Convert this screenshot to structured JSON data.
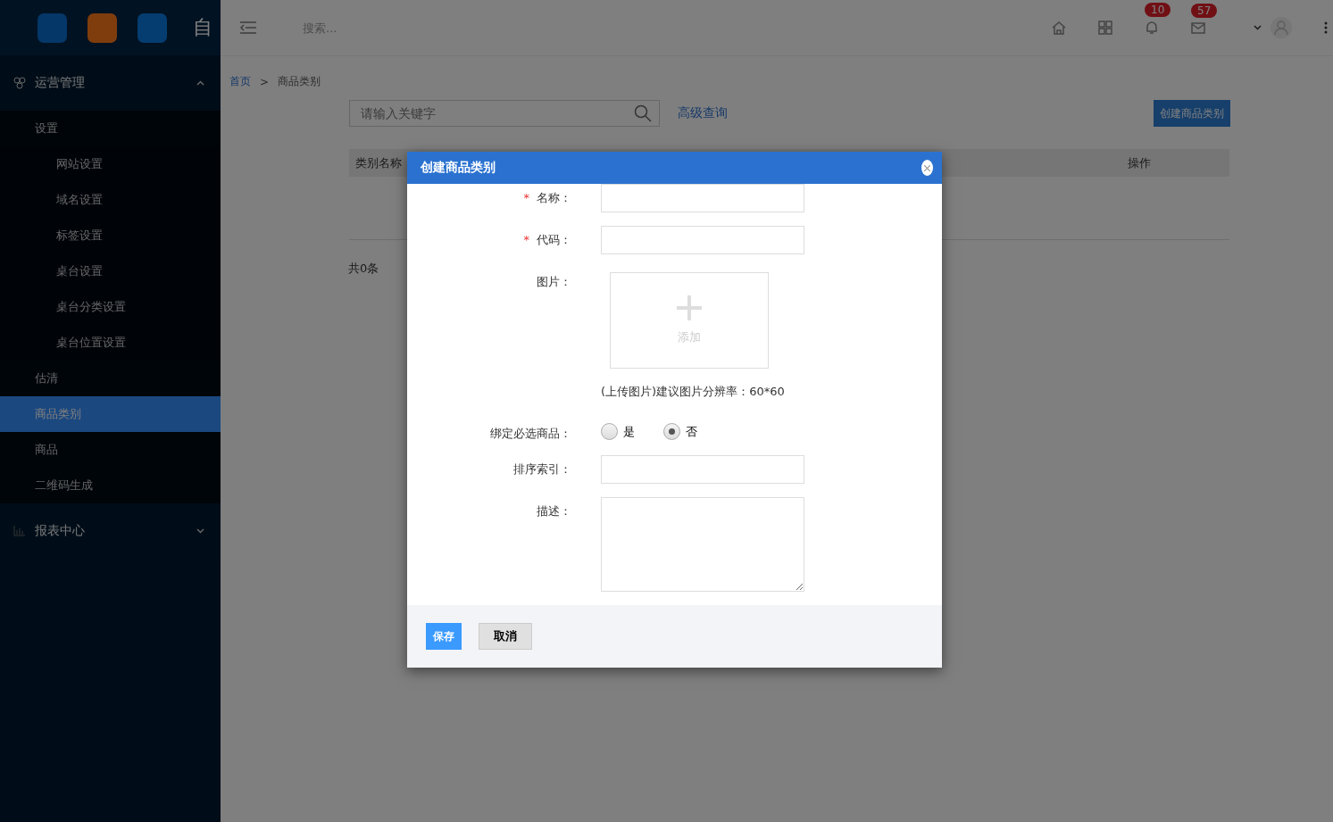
{
  "sidebar": {
    "logo_text": "自",
    "groups": [
      {
        "label": "运营管理",
        "expanded": true,
        "children": [
          {
            "label": "设置",
            "selected": false,
            "children": [
              {
                "label": "网站设置",
                "selected": false
              },
              {
                "label": "域名设置",
                "selected": false
              },
              {
                "label": "标签设置",
                "selected": false
              },
              {
                "label": "桌台设置",
                "selected": false
              },
              {
                "label": "桌台分类设置",
                "selected": false
              },
              {
                "label": "桌台位置设置",
                "selected": false
              }
            ]
          },
          {
            "label": "估清",
            "selected": false
          },
          {
            "label": "商品类别",
            "selected": true
          },
          {
            "label": "商品",
            "selected": false
          },
          {
            "label": "二维码生成",
            "selected": false
          }
        ]
      },
      {
        "label": "报表中心",
        "expanded": false
      }
    ]
  },
  "topbar": {
    "search_placeholder": "搜索...",
    "notifications": "10",
    "messages": "57"
  },
  "breadcrumb": {
    "separator": ">",
    "items": [
      "首页",
      "商品类别"
    ]
  },
  "toolbar": {
    "search_placeholder": "请输入关键字",
    "advanced_link": "高级查询",
    "create_button": "创建商品类别"
  },
  "table": {
    "columns": [
      "类别名称",
      "操作"
    ],
    "total": "共0条"
  },
  "modal": {
    "title": "创建商品类别",
    "required_mark": "*",
    "fields": [
      {
        "kind": "text",
        "label": "名称：",
        "required": true
      },
      {
        "kind": "text",
        "label": "代码：",
        "required": true
      },
      {
        "kind": "upload",
        "label": "图片：",
        "required": false,
        "button": "添加",
        "hint": "(上传图片)建议图片分辨率：60*60"
      },
      {
        "kind": "radio",
        "label": "绑定必选商品：",
        "required": false,
        "options": [
          {
            "label": "是",
            "selected": false
          },
          {
            "label": "否",
            "selected": true
          }
        ]
      },
      {
        "kind": "text",
        "label": "排序索引：",
        "required": false
      },
      {
        "kind": "textarea",
        "label": "描述：",
        "required": false
      }
    ],
    "save": "保存",
    "cancel": "取消"
  }
}
